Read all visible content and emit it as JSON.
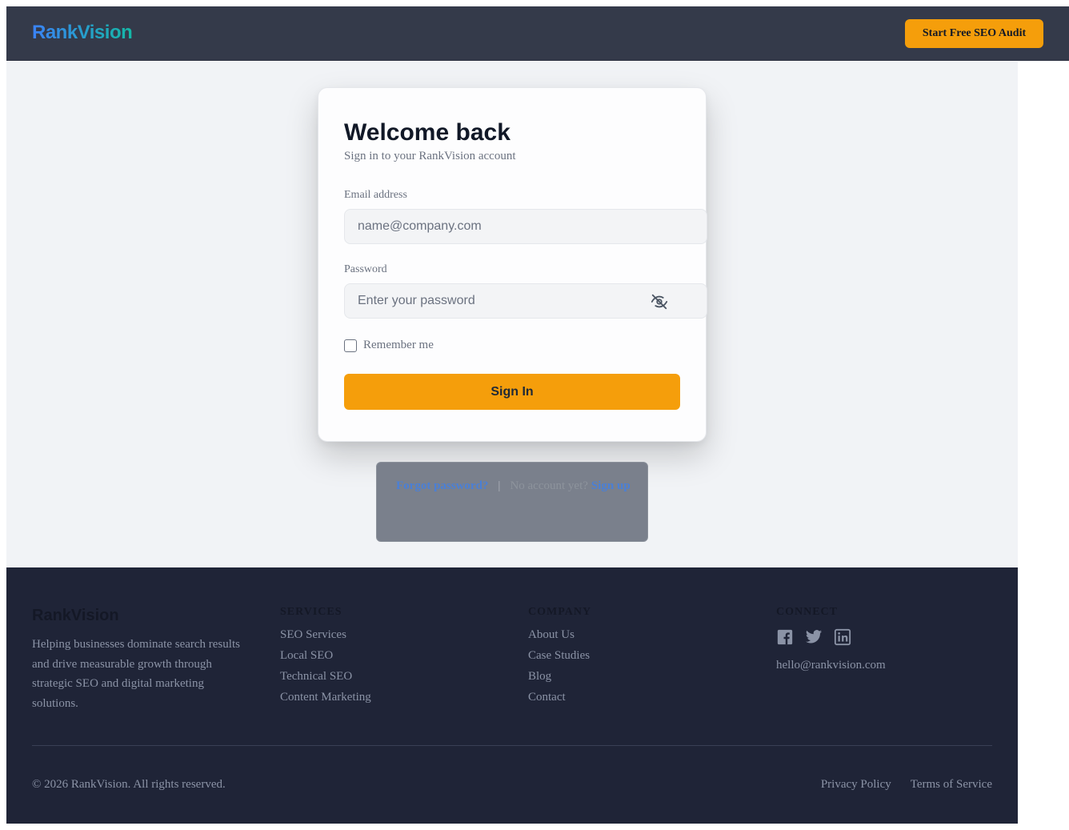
{
  "header": {
    "logo": "RankVision",
    "cta_label": "Start Free SEO Audit"
  },
  "login": {
    "title": "Welcome back",
    "subtitle": "Sign in to your RankVision account",
    "email_label": "Email address",
    "email_placeholder": "name@company.com",
    "password_label": "Password",
    "password_placeholder": "Enter your password",
    "password_toggle_icon": "eye-off-icon",
    "remember_label": "Remember me",
    "submit_label": "Sign In"
  },
  "below_card": {
    "forgot_label": "Forgot password?",
    "separator": "|",
    "no_account_text": "No account yet?",
    "signup_label": "Sign up"
  },
  "footer": {
    "brand": "RankVision",
    "description": "Helping businesses dominate search results and drive measurable growth through strategic SEO and digital marketing solutions.",
    "services": {
      "heading": "SERVICES",
      "links": [
        "SEO Services",
        "Local SEO",
        "Technical SEO",
        "Content Marketing"
      ]
    },
    "company": {
      "heading": "COMPANY",
      "links": [
        "About Us",
        "Case Studies",
        "Blog",
        "Contact"
      ]
    },
    "connect": {
      "heading": "CONNECT",
      "social_icons": [
        "facebook-icon",
        "twitter-icon",
        "linkedin-icon"
      ],
      "email": "hello@rankvision.com"
    },
    "copyright": "© 2026 RankVision. All rights reserved.",
    "legal": {
      "privacy": "Privacy Policy",
      "terms": "Terms of Service"
    }
  },
  "colors": {
    "accent": "#f59e0b",
    "header_bg": "#343a4a",
    "footer_bg": "#1f2437",
    "link_blue": "#4a7fd6"
  }
}
